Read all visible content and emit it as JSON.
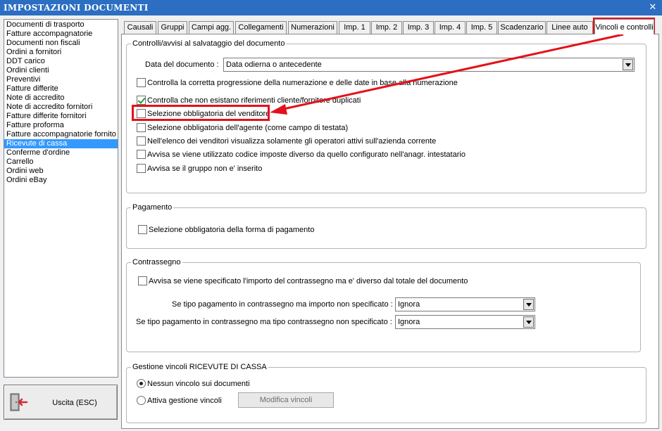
{
  "window": {
    "title": "IMPOSTAZIONI DOCUMENTI",
    "close_glyph": "✕"
  },
  "documents": [
    "Documenti di trasporto",
    "Fatture accompagnatorie",
    "Documenti non fiscali",
    "Ordini a fornitori",
    "DDT carico",
    "Ordini clienti",
    "Preventivi",
    "Fatture differite",
    "Note di accredito",
    "Note di accredito fornitori",
    "Fatture differite fornitori",
    "Fatture proforma",
    "Fatture accompagnatorie fornito",
    "Ricevute di cassa",
    "Conferme d'ordine",
    "Carrello",
    "Ordini web",
    "Ordini eBay"
  ],
  "selected_document": "Ricevute di cassa",
  "exit_button": {
    "label": "Uscita (ESC)",
    "icon": "exit-door-icon"
  },
  "tabs": [
    "Causali",
    "Gruppi",
    "Campi agg.",
    "Collegamenti",
    "Numerazioni",
    "Imp. 1",
    "Imp. 2",
    "Imp. 3",
    "Imp. 4",
    "Imp. 5",
    "Scadenzario",
    "Linee auto",
    "Vincoli e controlli"
  ],
  "active_tab": "Vincoli e controlli",
  "group_controlli": {
    "title": "Controlli/avvisi al salvataggio del documento",
    "date_label": "Data del documento :",
    "date_value": "Data odierna o antecedente",
    "checks": [
      {
        "label": "Controlla la corretta progressione della numerazione e delle date in base alla numerazione",
        "checked": false
      },
      {
        "label": "Controlla che non esistano riferimenti cliente/fornitore duplicati",
        "checked": true
      },
      {
        "label": "Selezione obbligatoria del venditore",
        "checked": false
      },
      {
        "label": "Selezione obbligatoria dell'agente (come campo di testata)",
        "checked": false
      },
      {
        "label": "Nell'elenco dei venditori visualizza solamente gli operatori attivi sull'azienda corrente",
        "checked": false
      },
      {
        "label": "Avvisa se viene utilizzato codice imposte diverso da quello configurato nell'anagr. intestatario",
        "checked": false
      },
      {
        "label": "Avvisa se il gruppo non e' inserito",
        "checked": false
      }
    ]
  },
  "group_pagamento": {
    "title": "Pagamento",
    "check": {
      "label": "Selezione obbligatoria della forma di pagamento",
      "checked": false
    }
  },
  "group_contrassegno": {
    "title": "Contrassegno",
    "check": {
      "label": "Avvisa se viene specificato l'importo del contrassegno ma e' diverso dal totale del documento",
      "checked": false
    },
    "row1_label": "Se tipo pagamento in contrassegno ma importo non specificato :",
    "row1_value": "Ignora",
    "row2_label": "Se tipo pagamento in contrassegno ma tipo contrassegno non specificato :",
    "row2_value": "Ignora"
  },
  "group_vincoli": {
    "title": "Gestione vincoli RICEVUTE DI CASSA",
    "radio1": {
      "label": "Nessun vincolo sui documenti",
      "checked": true
    },
    "radio2": {
      "label": "Attiva gestione vincoli",
      "checked": false
    },
    "modify_button": "Modifica vincoli"
  },
  "annotation_color": "#e5101a"
}
